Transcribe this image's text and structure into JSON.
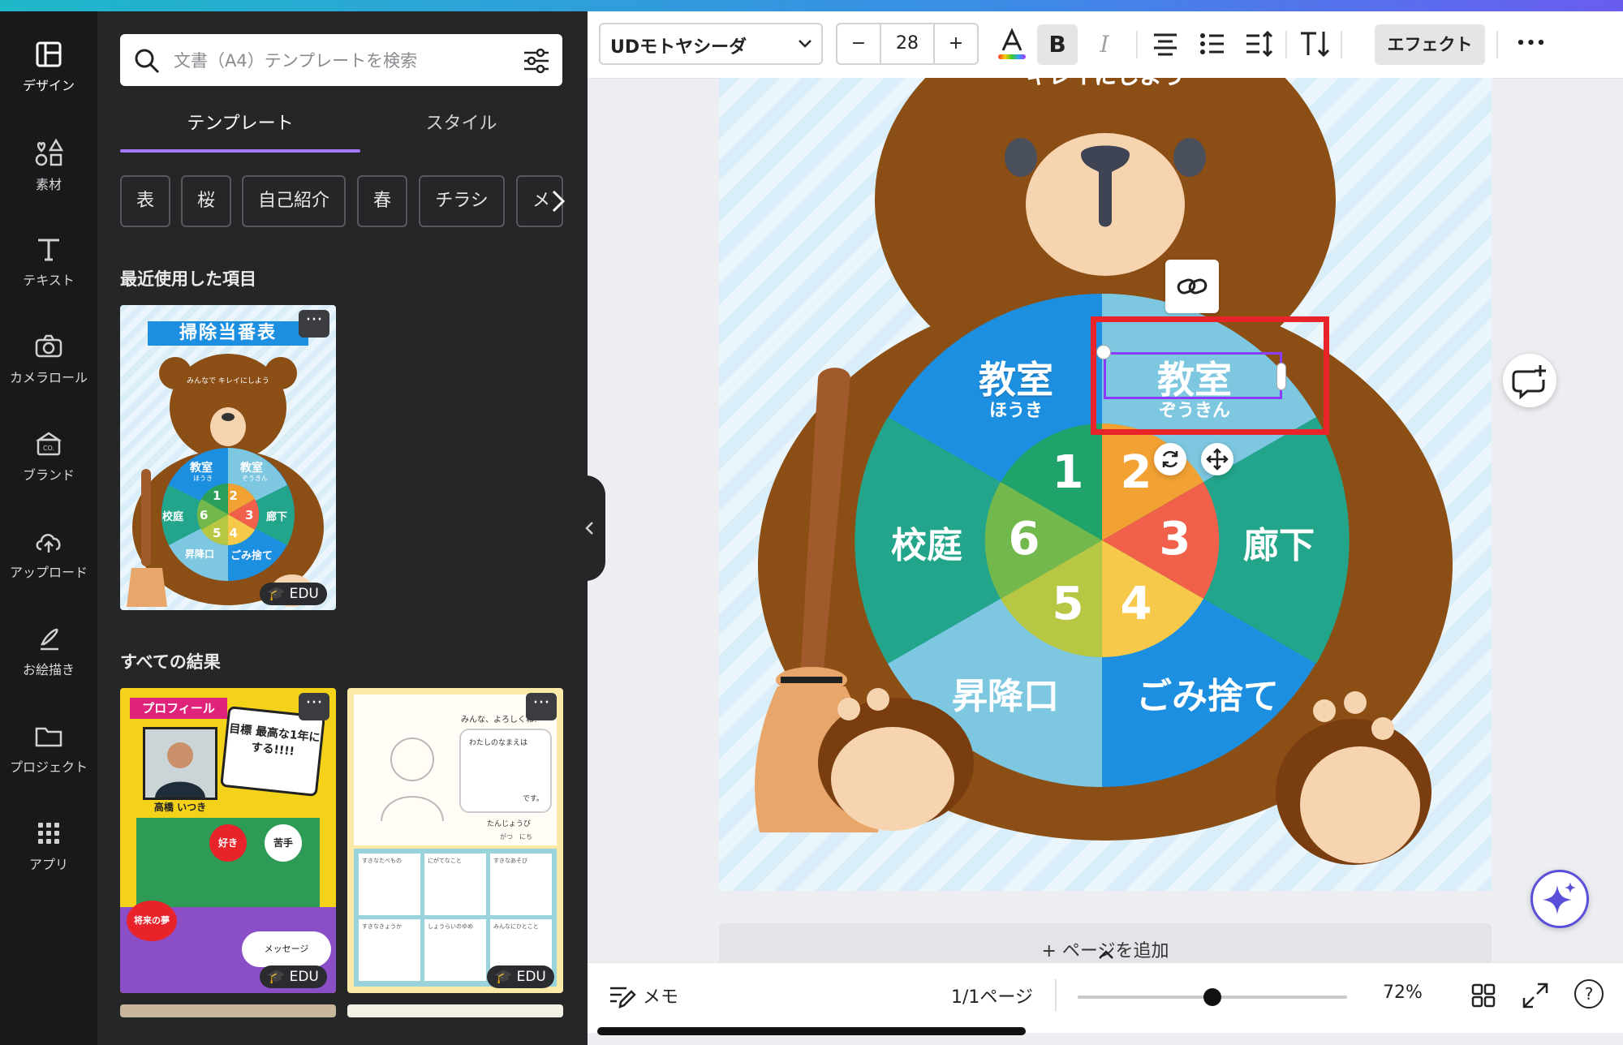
{
  "rail": {
    "items": [
      {
        "label": "デザイン",
        "icon": "layout-icon"
      },
      {
        "label": "素材",
        "icon": "shapes-icon"
      },
      {
        "label": "テキスト",
        "icon": "text-icon"
      },
      {
        "label": "カメラロール",
        "icon": "camera-icon"
      },
      {
        "label": "ブランド",
        "icon": "brand-icon"
      },
      {
        "label": "アップロード",
        "icon": "cloud-upload-icon"
      },
      {
        "label": "お絵描き",
        "icon": "draw-icon"
      },
      {
        "label": "プロジェクト",
        "icon": "folder-icon"
      },
      {
        "label": "アプリ",
        "icon": "apps-grid-icon"
      }
    ]
  },
  "panel": {
    "search_placeholder": "文書（A4）テンプレートを検索",
    "tabs": [
      "テンプレート",
      "スタイル"
    ],
    "chips": [
      "表",
      "桜",
      "自己紹介",
      "春",
      "チラシ",
      "メ"
    ],
    "recent_heading": "最近使用した項目",
    "all_heading": "すべての結果",
    "recent_thumb": {
      "title": "掃除当番表",
      "subtitle": "みんなで キレイにしよう",
      "badge": "EDU",
      "areas": [
        "教室",
        "教室",
        "廊下",
        "ごみ捨て",
        "昇降口",
        "校庭"
      ],
      "area_subs": [
        "ほうき",
        "ぞうきん"
      ],
      "numbers": [
        "1",
        "2",
        "3",
        "4",
        "5",
        "6"
      ]
    },
    "result1": {
      "title": "プロフィール",
      "goal": "目標 最高な1年にする!!!!",
      "name": "高橋 いつき",
      "badge": "EDU",
      "labels": [
        "好き",
        "苦手",
        "将来の夢",
        "メッセージ"
      ]
    },
    "result2": {
      "greeting": "みんな、よろしくね!",
      "name_label": "わたしのなまえは",
      "desu": "です。",
      "birthday": "たんじょうび",
      "month_day": "がつ　にち",
      "cells": [
        "すきなたべもの",
        "にがてなこと",
        "すきなあそび",
        "すきなきょうか",
        "しょうらいのゆめ",
        "みんなにひとこと"
      ],
      "badge": "EDU"
    }
  },
  "toolbar": {
    "font": "UDモトヤシーダ",
    "size": "28",
    "minus": "−",
    "plus": "+",
    "bold": "B",
    "italic": "I",
    "effects": "エフェクト",
    "more": "•••"
  },
  "canvas": {
    "top_text": "キレイにしよう",
    "areas": {
      "top_left": {
        "main": "教室",
        "sub": "ほうき"
      },
      "top_right": {
        "main": "教室",
        "sub": "ぞうきん"
      },
      "right": {
        "main": "廊下"
      },
      "bottom_right": {
        "main": "ごみ捨て"
      },
      "bottom_left": {
        "main": "昇降口"
      },
      "left": {
        "main": "校庭"
      }
    },
    "numbers": [
      "1",
      "2",
      "3",
      "4",
      "5",
      "6"
    ],
    "add_page": "+ ページを追加",
    "colors": {
      "bear": "#8b4e14",
      "accent": "#8b3dff",
      "highlight": "#e8232a"
    }
  },
  "bottom": {
    "memo": "メモ",
    "page_indicator": "1/1ページ",
    "zoom": "72%",
    "zoom_fraction": 0.5,
    "help": "?"
  }
}
